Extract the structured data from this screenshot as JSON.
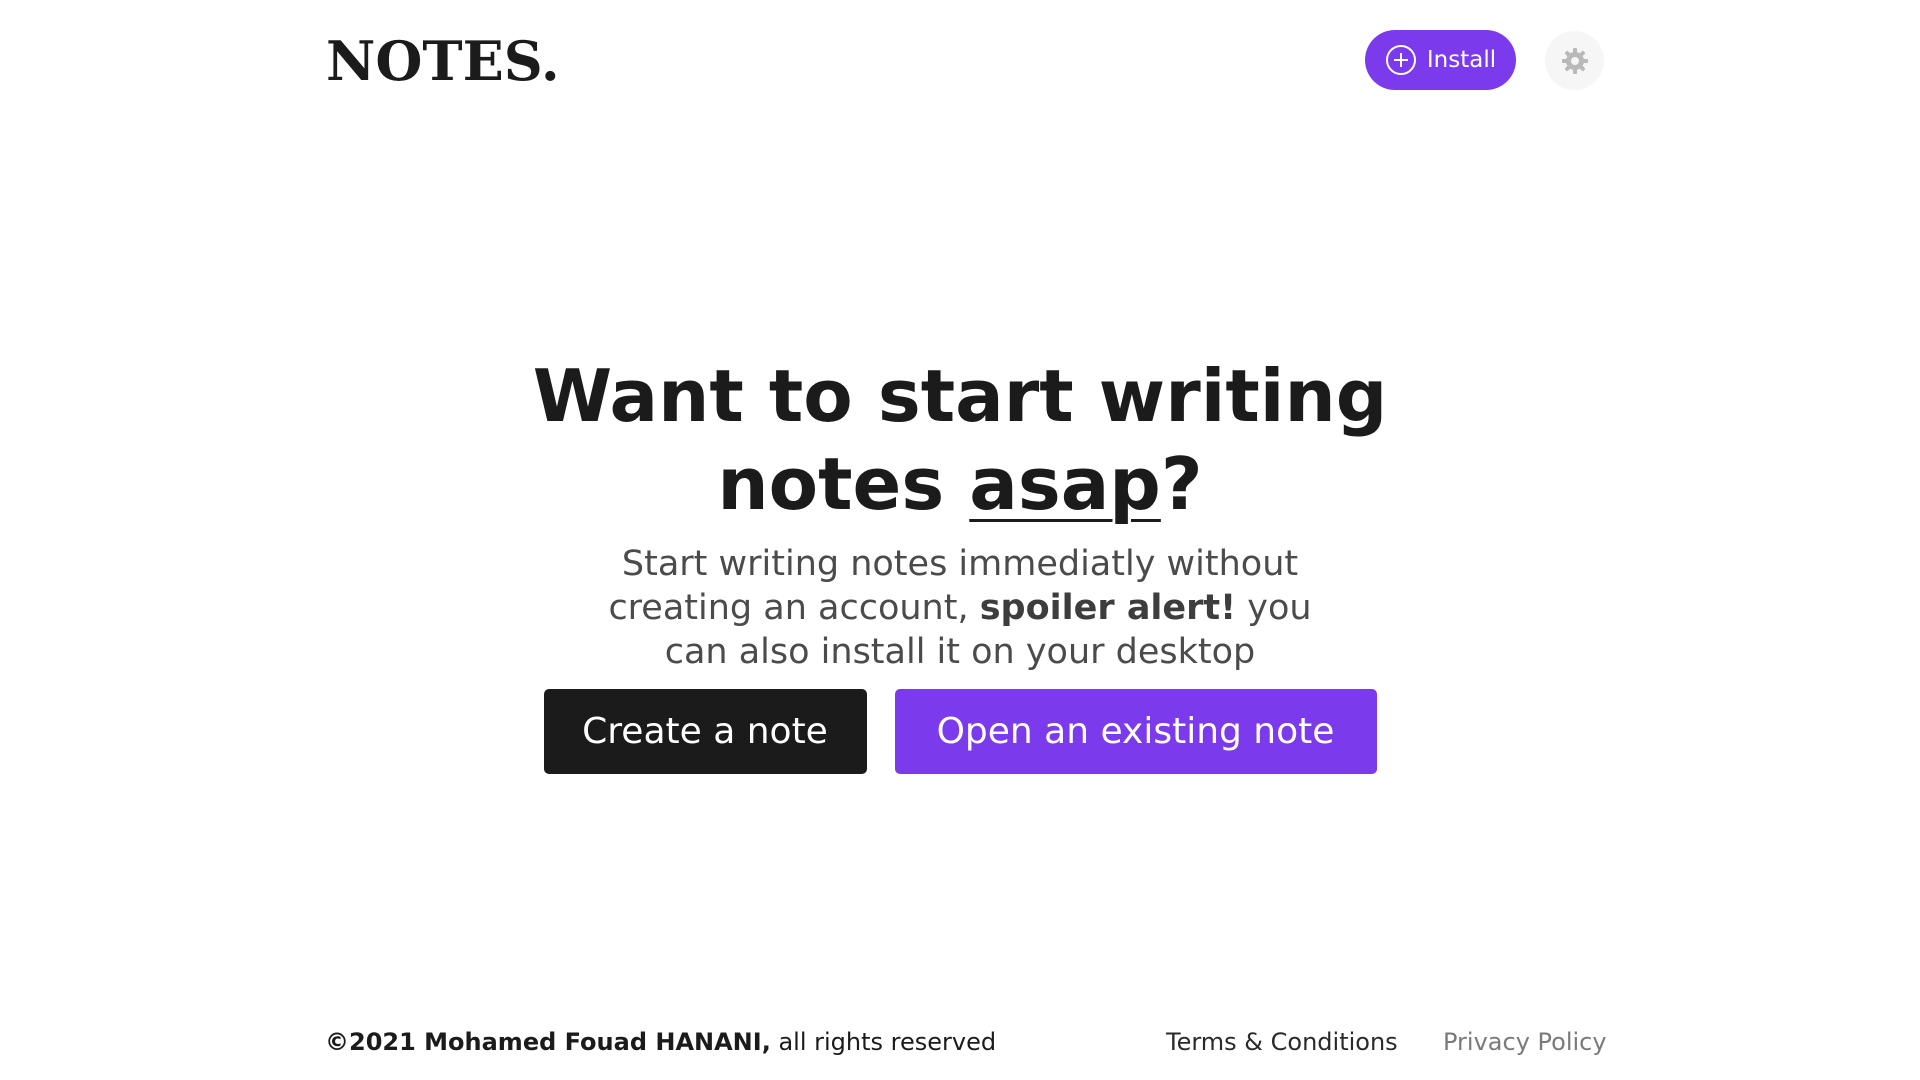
{
  "colors": {
    "accent": "#7c3aed",
    "dark_button": "#1b1b1c",
    "text_primary": "#1b1b1b",
    "text_secondary": "#4b4b4b",
    "link_muted": "#7a7a7a"
  },
  "header": {
    "logo": "NOTES.",
    "install_label": "Install",
    "install_icon": "plus-circle-icon",
    "settings_icon": "gear-icon"
  },
  "hero": {
    "title_part1": "Want to start writing notes ",
    "title_highlight": "asap",
    "title_part2": "?",
    "subtitle_part1": "Start writing notes immediatly without creating an account, ",
    "subtitle_bold": "spoiler alert!",
    "subtitle_part2": " you can also install it on your desktop"
  },
  "actions": {
    "create_label": "Create a note",
    "open_label": "Open an existing note"
  },
  "footer": {
    "copyright_owner": "©2021 Mohamed Fouad HANANI,",
    "copyright_rest": " all rights reserved",
    "terms_label": "Terms & Conditions",
    "privacy_label": "Privacy Policy"
  }
}
